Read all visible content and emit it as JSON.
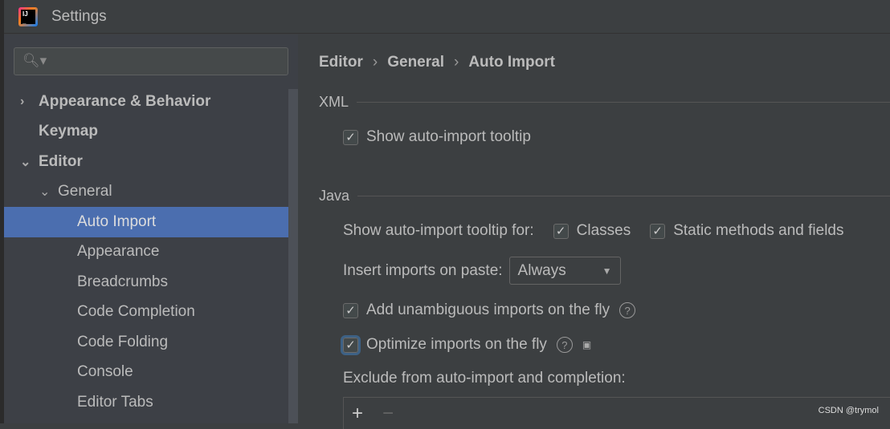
{
  "window": {
    "title": "Settings",
    "logo_text": "IJ"
  },
  "search": {
    "placeholder": ""
  },
  "sidebar": {
    "items": [
      {
        "label": "Appearance & Behavior"
      },
      {
        "label": "Keymap"
      },
      {
        "label": "Editor"
      },
      {
        "label": "General"
      },
      {
        "label": "Auto Import",
        "selected": true
      },
      {
        "label": "Appearance"
      },
      {
        "label": "Breadcrumbs"
      },
      {
        "label": "Code Completion"
      },
      {
        "label": "Code Folding"
      },
      {
        "label": "Console"
      },
      {
        "label": "Editor Tabs"
      }
    ]
  },
  "breadcrumb": [
    "Editor",
    "General",
    "Auto Import"
  ],
  "xml": {
    "title": "XML",
    "show_tooltip": {
      "label": "Show auto-import tooltip",
      "checked": true
    }
  },
  "java": {
    "title": "Java",
    "tooltip_for_label": "Show auto-import tooltip for:",
    "classes": {
      "label": "Classes",
      "checked": true
    },
    "static": {
      "label": "Static methods and fields",
      "checked": true
    },
    "insert_label": "Insert imports on paste:",
    "insert_value": "Always",
    "add_unambiguous": {
      "label": "Add unambiguous imports on the fly",
      "checked": true
    },
    "optimize": {
      "label": "Optimize imports on the fly",
      "checked": true
    },
    "exclude_label": "Exclude from auto-import and completion:",
    "add_symbol": "+",
    "remove_symbol": "−"
  },
  "watermark": "CSDN @trymol",
  "colors": {
    "selection": "#4b6eaf",
    "background": "#3c3f41"
  }
}
